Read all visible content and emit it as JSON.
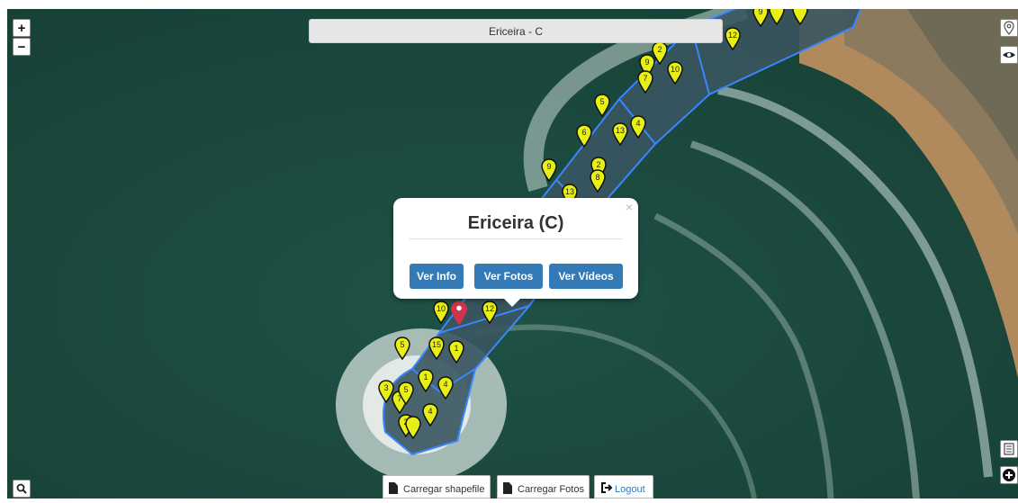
{
  "map": {
    "title": "Ericeira - C",
    "zoom_in": "+",
    "zoom_out": "−"
  },
  "popup": {
    "title": "Ericeira (C)",
    "close": "×",
    "buttons": [
      "Ver Info",
      "Ver Fotos",
      "Ver Vídeos"
    ]
  },
  "toolbar": {
    "shapefile": "Carregar shapefile",
    "fotos": "Carregar Fotos",
    "logout": "Logout"
  },
  "markers": [
    {
      "label": "2"
    },
    {
      "label": "9"
    },
    {
      "label": "7"
    },
    {
      "label": "10"
    },
    {
      "label": "12"
    },
    {
      "label": "5"
    },
    {
      "label": "6"
    },
    {
      "label": "13"
    },
    {
      "label": "4"
    },
    {
      "label": "9"
    },
    {
      "label": "2"
    },
    {
      "label": "8"
    },
    {
      "label": "13"
    },
    {
      "label": "10"
    },
    {
      "label": "12"
    },
    {
      "label": "5"
    },
    {
      "label": "15"
    },
    {
      "label": "1"
    },
    {
      "label": "1"
    },
    {
      "label": "4"
    },
    {
      "label": "3"
    },
    {
      "label": "7"
    },
    {
      "label": "5"
    },
    {
      "label": "4"
    },
    {
      "label": "2"
    },
    {
      "label": ""
    },
    {
      "label": "9"
    },
    {
      "label": ""
    },
    {
      "label": ""
    }
  ],
  "colors": {
    "marker": "#e8ef17",
    "selected_marker": "#d0344a",
    "polygon": "#3a86ff",
    "button": "#337ab7"
  }
}
